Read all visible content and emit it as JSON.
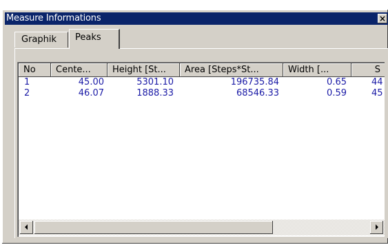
{
  "window": {
    "title": "Measure Informations",
    "close_glyph": "×",
    "colors": {
      "titlebar": "#0a246a",
      "face": "#d4d0c8",
      "value_text": "#1a1aa6"
    }
  },
  "tabs": [
    {
      "label": "Graphik",
      "active": false
    },
    {
      "label": "Peaks",
      "active": true
    }
  ],
  "table": {
    "columns": [
      "No",
      "Cente...",
      "Height [St...",
      "Area [Steps*St...",
      "Width [...",
      "S"
    ],
    "rows": [
      [
        "1",
        "45.00",
        "5301.10",
        "196735.84",
        "0.65",
        "44"
      ],
      [
        "2",
        "46.07",
        "1888.33",
        "68546.33",
        "0.59",
        "45"
      ]
    ]
  },
  "scrollbar": {
    "left_arrow_icon": "arrow-left-icon",
    "right_arrow_icon": "arrow-right-icon"
  }
}
